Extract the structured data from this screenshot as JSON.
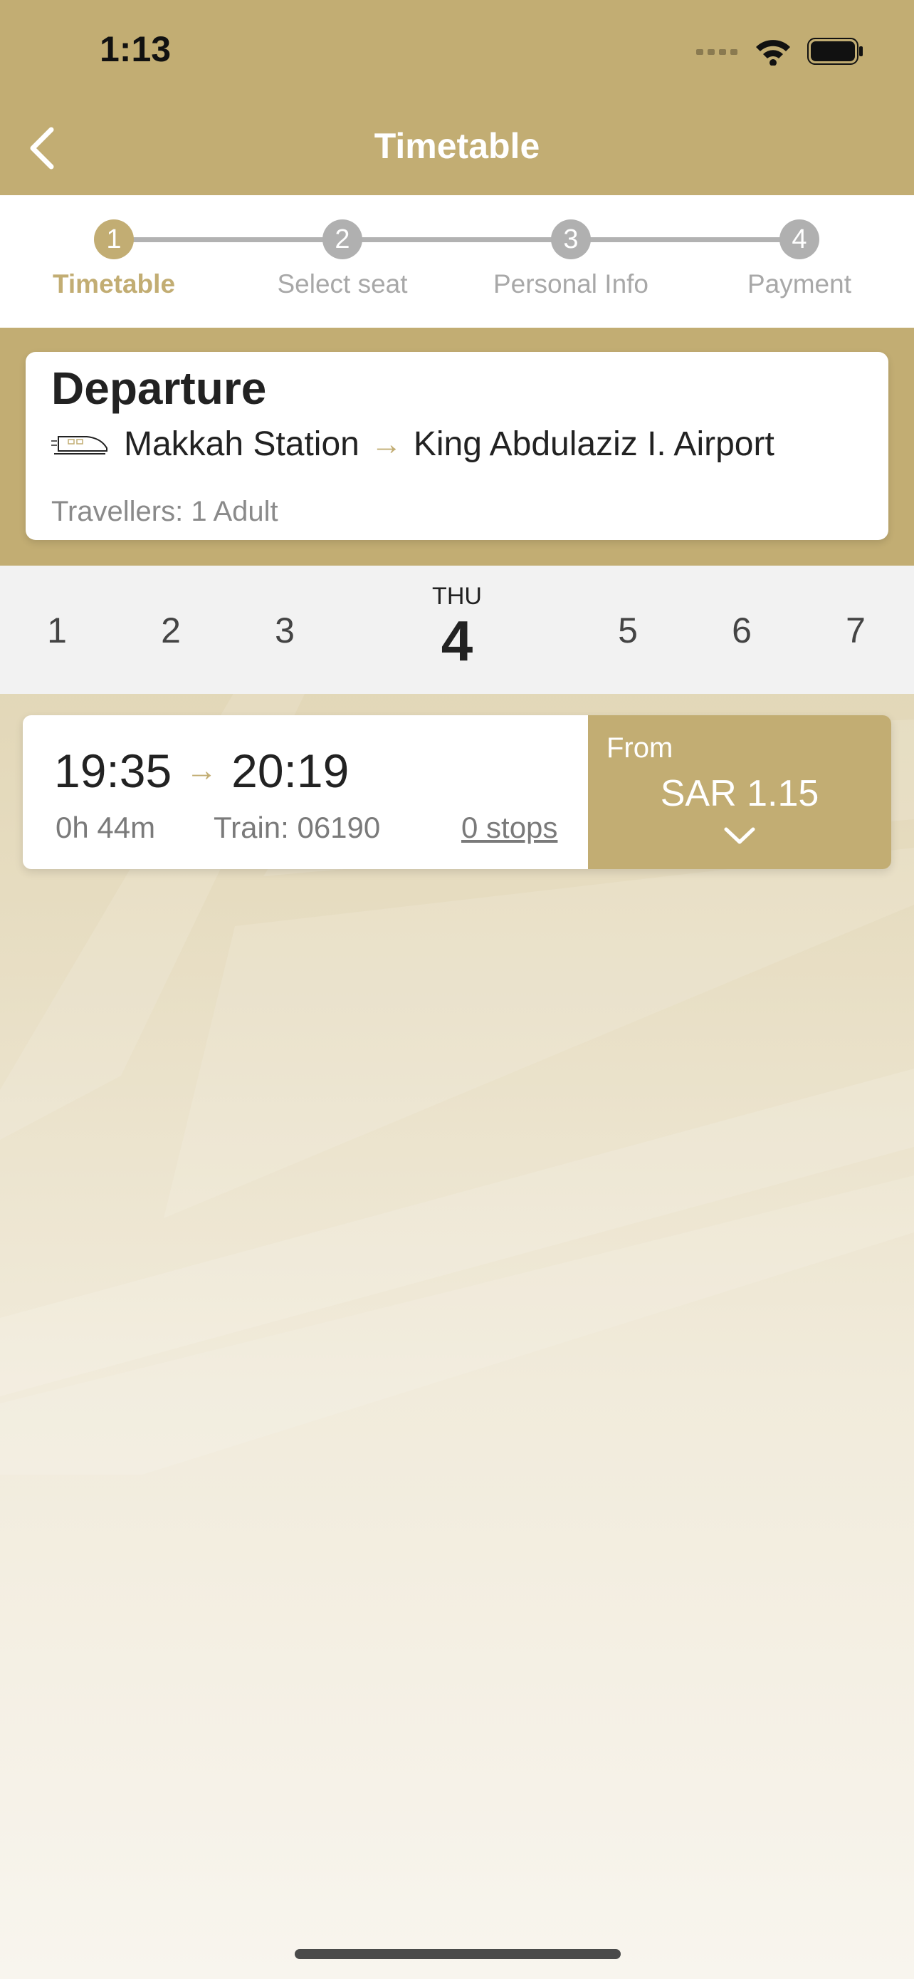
{
  "status_bar": {
    "time": "1:13",
    "icons": [
      "signal-icon",
      "wifi-icon",
      "battery-icon"
    ]
  },
  "nav": {
    "title": "Timetable",
    "back_icon": "chevron-left-icon"
  },
  "stepper": {
    "steps": [
      {
        "number": "1",
        "label": "Timetable",
        "active": true
      },
      {
        "number": "2",
        "label": "Select seat",
        "active": false
      },
      {
        "number": "3",
        "label": "Personal Info",
        "active": false
      },
      {
        "number": "4",
        "label": "Payment",
        "active": false
      }
    ]
  },
  "departure": {
    "title": "Departure",
    "train_icon": "train-icon",
    "from": "Makkah Station",
    "arrow": "→",
    "to": "King Abdulaziz I. Airport",
    "travellers": "Travellers: 1 Adult"
  },
  "dates": {
    "before": [
      "1",
      "2",
      "3"
    ],
    "selected": {
      "dow": "THU",
      "day": "4"
    },
    "after": [
      "5",
      "6",
      "7"
    ]
  },
  "trip": {
    "depart": "19:35",
    "arrow": "→",
    "arrive": "20:19",
    "duration": "0h 44m",
    "train": "Train: 06190",
    "stops": "0 stops",
    "from_label": "From",
    "price": "SAR 1.15",
    "expand_icon": "chevron-down-icon"
  },
  "colors": {
    "brand_gold": "#c2ad73",
    "text_dark": "#222222",
    "text_muted": "#8a8a8a"
  }
}
